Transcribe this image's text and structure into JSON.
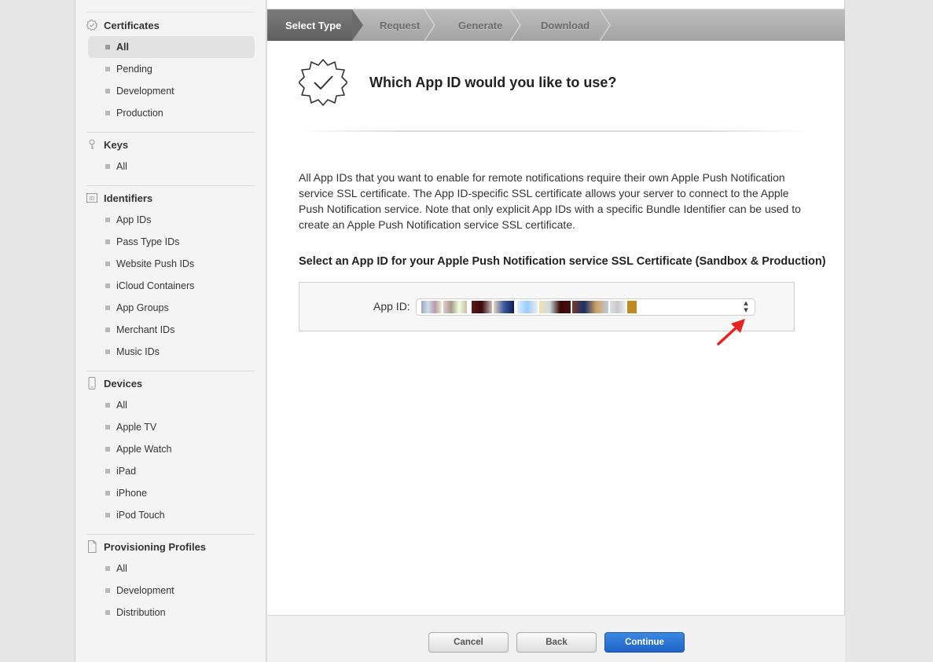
{
  "sidebar": {
    "sections": [
      {
        "title": "Certificates",
        "icon": "certificate-badge-icon",
        "items": [
          "All",
          "Pending",
          "Development",
          "Production"
        ],
        "active_index": 0
      },
      {
        "title": "Keys",
        "icon": "key-icon",
        "items": [
          "All"
        ]
      },
      {
        "title": "Identifiers",
        "icon": "id-icon",
        "icon_text": "ID",
        "items": [
          "App IDs",
          "Pass Type IDs",
          "Website Push IDs",
          "iCloud Containers",
          "App Groups",
          "Merchant IDs",
          "Music IDs"
        ]
      },
      {
        "title": "Devices",
        "icon": "device-icon",
        "items": [
          "All",
          "Apple TV",
          "Apple Watch",
          "iPad",
          "iPhone",
          "iPod Touch"
        ]
      },
      {
        "title": "Provisioning Profiles",
        "icon": "document-icon",
        "items": [
          "All",
          "Development",
          "Distribution"
        ]
      }
    ]
  },
  "steps": [
    "Select Type",
    "Request",
    "Generate",
    "Download"
  ],
  "main": {
    "title": "Which App ID would you like to use?",
    "description": "All App IDs that you want to enable for remote notifications require their own Apple Push Notification service SSL certificate. The App ID-specific SSL certificate allows your server to connect to the Apple Push Notification service. Note that only explicit App IDs with a specific Bundle Identifier can be used to create an Apple Push Notification service SSL certificate.",
    "select_heading": "Select an App ID for your Apple Push Notification service SSL Certificate (Sandbox & Production)",
    "app_id_label": "App ID:"
  },
  "buttons": {
    "cancel": "Cancel",
    "back": "Back",
    "continue": "Continue"
  },
  "colors": {
    "accent_blue": "#2a70d4",
    "annotation_red": "#e8231f",
    "step_active": "#6b6b6b"
  }
}
